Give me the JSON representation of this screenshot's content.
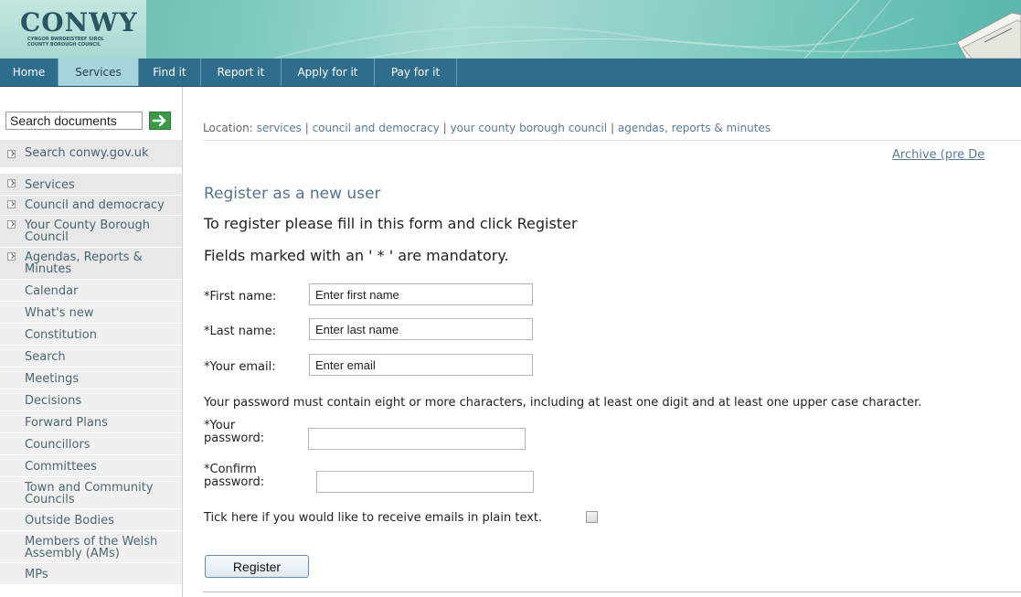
{
  "banner": {
    "logo_text": "CONWY",
    "logo_subtitle": "CYNGOR BWRDEISTREF SIROL COUNTY BOROUGH COUNCIL"
  },
  "nav": {
    "items": [
      {
        "label": "Home",
        "active": false
      },
      {
        "label": "Services",
        "active": true
      },
      {
        "label": "Find it",
        "active": false
      },
      {
        "label": "Report it",
        "active": false
      },
      {
        "label": "Apply for it",
        "active": false
      },
      {
        "label": "Pay for it",
        "active": false
      }
    ]
  },
  "sidebar": {
    "search_value": "Search documents",
    "search_site_label": "Search conwy.gov.uk",
    "items": [
      {
        "label": "Services",
        "type": "top"
      },
      {
        "label": "Council and democracy",
        "type": "top"
      },
      {
        "label": "Your County Borough Council",
        "type": "top"
      },
      {
        "label": "Agendas, Reports & Minutes",
        "type": "top"
      },
      {
        "label": "Calendar",
        "type": "sub"
      },
      {
        "label": "What's new",
        "type": "sub"
      },
      {
        "label": "Constitution",
        "type": "sub"
      },
      {
        "label": "Search",
        "type": "sub"
      },
      {
        "label": "Meetings",
        "type": "sub"
      },
      {
        "label": "Decisions",
        "type": "sub"
      },
      {
        "label": "Forward Plans",
        "type": "sub"
      },
      {
        "label": "Councillors",
        "type": "sub"
      },
      {
        "label": "Committees",
        "type": "sub"
      },
      {
        "label": "Town and Community Councils",
        "type": "sub"
      },
      {
        "label": "Outside Bodies",
        "type": "sub"
      },
      {
        "label": "Members of the Welsh Assembly (AMs)",
        "type": "sub"
      },
      {
        "label": "MPs",
        "type": "sub"
      }
    ]
  },
  "breadcrumb": {
    "prefix": "Location:",
    "links": [
      "services",
      "council and democracy",
      "your county borough council",
      "agendas, reports & minutes"
    ],
    "separator": "|"
  },
  "archive_link": "Archive (pre De",
  "form": {
    "title": "Register as a new user",
    "intro": "To register please fill in this form and click Register",
    "mandatory_note": "Fields marked with an ' * ' are mandatory.",
    "first_name_label": "*First name:",
    "first_name_value": "Enter first name",
    "last_name_label": "*Last name:",
    "last_name_value": "Enter last name",
    "email_label": "*Your email:",
    "email_value": "Enter email",
    "password_rule": "Your password must contain eight or more characters, including at least one digit and at least one upper case character.",
    "password_label": "*Your password:",
    "password_label_line1": "*Your",
    "password_label_line2": "password:",
    "confirm_label_line1": "*Confirm",
    "confirm_label_line2": "password:",
    "plain_text_label": "Tick here if you would like to receive emails in plain text.",
    "plain_text_checked": false,
    "register_label": "Register"
  },
  "colors": {
    "nav_bg": "#2e6e8c",
    "nav_active": "#a7d3dd",
    "title_color": "#557390",
    "link_color": "#5a7a9a",
    "go_button": "#3a9a45"
  },
  "icons": {
    "search_go": "arrow-right-icon",
    "sidebar_bullet": "expand-arrow-icon"
  }
}
